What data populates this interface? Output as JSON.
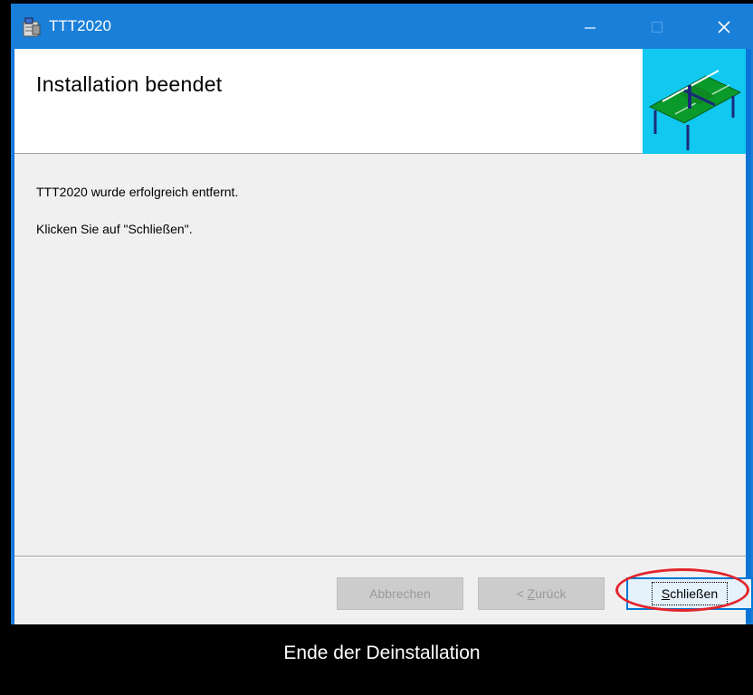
{
  "window": {
    "title": "TTT2020",
    "controls": {
      "minimize": "—",
      "maximize": "☐",
      "close": "✕"
    }
  },
  "banner": {
    "heading": "Installation beendet",
    "image_icon": "ping-pong-table-icon"
  },
  "body": {
    "message1": "TTT2020 wurde erfolgreich entfernt.",
    "message2": "Klicken Sie auf \"Schließen\"."
  },
  "buttons": {
    "cancel": "Abbrechen",
    "back_prefix": "< ",
    "back_accel": "Z",
    "back_rest": "urück",
    "close_accel": "S",
    "close_rest": "chließen"
  },
  "caption": "Ende der Deinstallation",
  "colors": {
    "titlebar": "#1a7fd8",
    "banner_art_bg": "#10c8f0",
    "annotation_ring": "#e3242b"
  }
}
